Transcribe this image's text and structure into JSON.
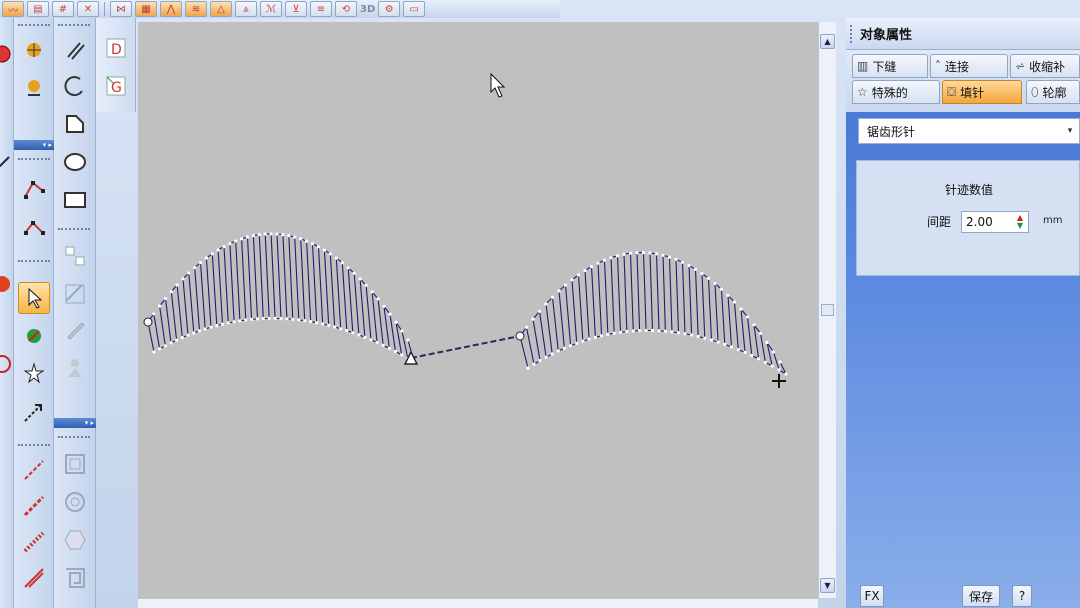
{
  "toolbar": {
    "text_3d": "3D",
    "buttons": [
      "stitch-run-icon",
      "satin-fill-icon",
      "tatami-fill-icon",
      "cross-stitch-icon",
      "outline-icon",
      "zoom-fit-icon",
      "zigzag-icon",
      "wave-icon",
      "reshape-icon",
      "lines-icon",
      "rotate-icon",
      "view-3d-icon"
    ]
  },
  "panel": {
    "title": "对象属性",
    "tabs": {
      "underlay": "下缝",
      "connect": "连接",
      "compensation": "收缩补",
      "special": "特殊的",
      "fill": "填针",
      "outline": "轮廓"
    },
    "fill_type": "锯齿形针",
    "group_title": "针迹数值",
    "spacing_label": "间距",
    "spacing_value": "2.00",
    "spacing_unit": "mm",
    "btn_fx": "FX",
    "btn_save": "保存",
    "btn_help": "?"
  },
  "colors": {
    "stitch": "#1f1d6e",
    "canvas": "#c0c0c0",
    "panel_blue": "#3f6fd0",
    "active_tab": "#f4a63c"
  }
}
